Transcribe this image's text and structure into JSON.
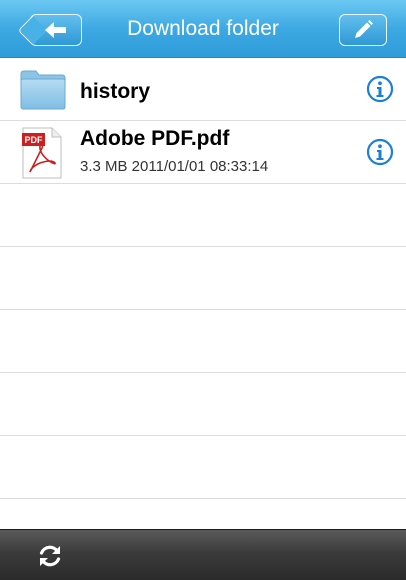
{
  "navbar": {
    "title": "Download folder",
    "back_icon": "arrow-left-icon",
    "edit_icon": "pencil-icon",
    "accent_color": "#3da9e3"
  },
  "files": [
    {
      "name": "history",
      "type": "folder",
      "icon": "folder-icon",
      "meta": ""
    },
    {
      "name": "Adobe PDF.pdf",
      "type": "pdf",
      "icon": "pdf-file-icon",
      "meta": "3.3 MB 2011/01/01 08:33:14",
      "badge": "PDF"
    }
  ],
  "info_icon": "info-icon",
  "toolbar": {
    "refresh_icon": "refresh-icon"
  }
}
